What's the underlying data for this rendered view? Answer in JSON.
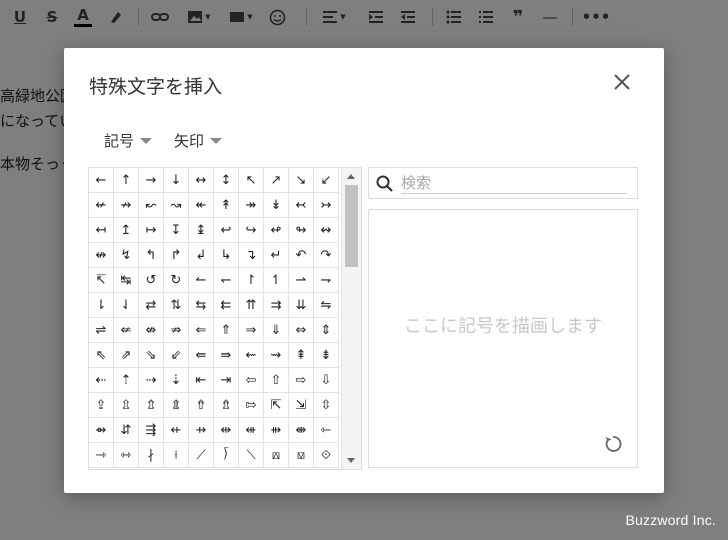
{
  "editor": {
    "text_lines": [
      "高緑地公園",
      "になってい",
      "本物そっく"
    ]
  },
  "watermark": "Buzzword Inc.",
  "dialog": {
    "title": "特殊文字を挿入",
    "category_dropdown": "記号",
    "subcategory_dropdown": "矢印",
    "search_placeholder": "検索",
    "draw_hint": "ここに記号を描画します"
  },
  "symbols": [
    [
      "←",
      "↑",
      "→",
      "↓",
      "↔",
      "↕",
      "↖",
      "↗",
      "↘",
      "↙"
    ],
    [
      "↚",
      "↛",
      "↜",
      "↝",
      "↞",
      "↟",
      "↠",
      "↡",
      "↢",
      "↣"
    ],
    [
      "↤",
      "↥",
      "↦",
      "↧",
      "↨",
      "↩",
      "↪",
      "↫",
      "↬",
      "↭"
    ],
    [
      "↮",
      "↯",
      "↰",
      "↱",
      "↲",
      "↳",
      "↴",
      "↵",
      "↶",
      "↷"
    ],
    [
      "↸",
      "↹",
      "↺",
      "↻",
      "↼",
      "↽",
      "↾",
      "↿",
      "⇀",
      "⇁"
    ],
    [
      "⇂",
      "⇃",
      "⇄",
      "⇅",
      "⇆",
      "⇇",
      "⇈",
      "⇉",
      "⇊",
      "⇋"
    ],
    [
      "⇌",
      "⇍",
      "⇎",
      "⇏",
      "⇐",
      "⇑",
      "⇒",
      "⇓",
      "⇔",
      "⇕"
    ],
    [
      "⇖",
      "⇗",
      "⇘",
      "⇙",
      "⇚",
      "⇛",
      "⇜",
      "⇝",
      "⇞",
      "⇟"
    ],
    [
      "⇠",
      "⇡",
      "⇢",
      "⇣",
      "⇤",
      "⇥",
      "⇦",
      "⇧",
      "⇨",
      "⇩"
    ],
    [
      "⇪",
      "⇫",
      "⇬",
      "⇭",
      "⇮",
      "⇯",
      "⇰",
      "⇱",
      "⇲",
      "⇳"
    ],
    [
      "⇴",
      "⇵",
      "⇶",
      "⇷",
      "⇸",
      "⇹",
      "⇺",
      "⇻",
      "⇼",
      "⇽"
    ],
    [
      "⇾",
      "⇿",
      "∤",
      "⟊",
      "⟋",
      "⟌",
      "⟍",
      "⟎",
      "⟏",
      "⟐"
    ]
  ],
  "colors": {
    "overlay": "rgba(0,0,0,0.5)",
    "dialog_bg": "#ffffff",
    "hint_text": "#c8c8c8"
  }
}
